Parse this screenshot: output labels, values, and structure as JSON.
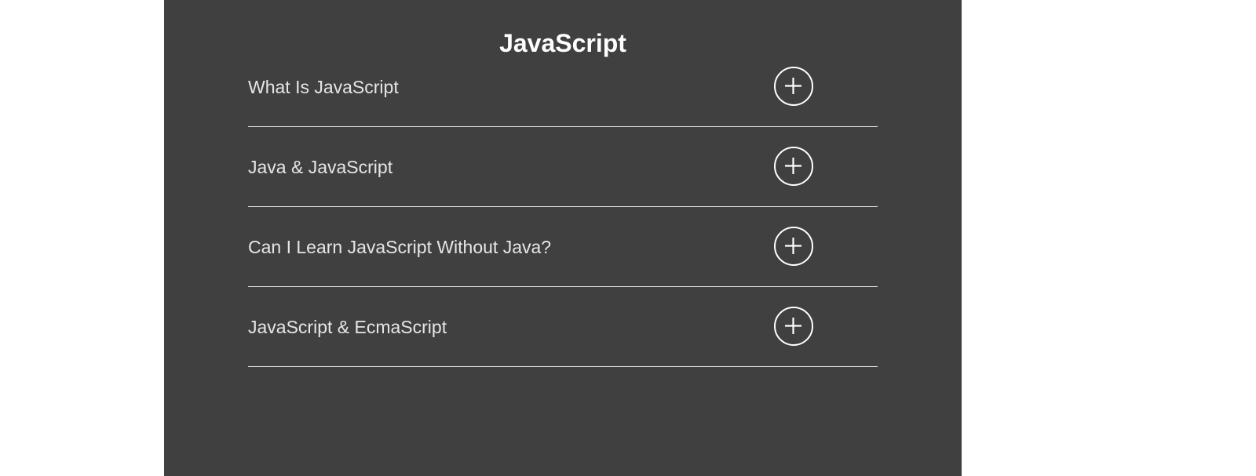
{
  "section": {
    "title": "JavaScript",
    "background": "#414041",
    "items": [
      {
        "label": "What Is JavaScript",
        "icon": "plus-circle-icon"
      },
      {
        "label": "Java & JavaScript",
        "icon": "plus-circle-icon"
      },
      {
        "label": "Can I Learn JavaScript Without Java?",
        "icon": "plus-circle-icon"
      },
      {
        "label": "JavaScript & EcmaScript",
        "icon": "plus-circle-icon"
      }
    ]
  }
}
